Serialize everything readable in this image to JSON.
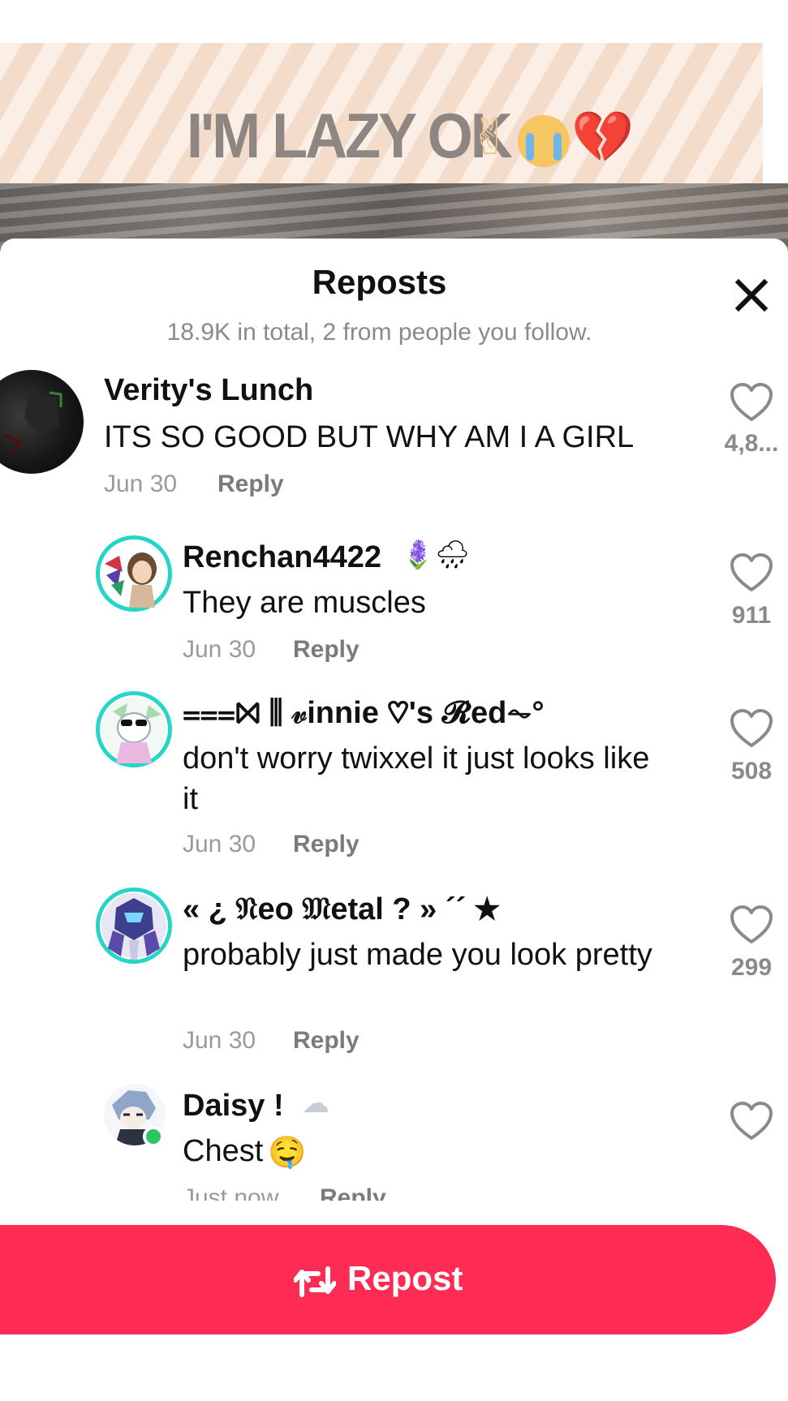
{
  "video": {
    "banner_text": "I'M LAZY OK",
    "banner_emojis": [
      "✌",
      "😭",
      "💔"
    ]
  },
  "sheet": {
    "title": "Reposts",
    "subtitle": "18.9K in total, 2 from people you follow."
  },
  "comments": [
    {
      "username": "Verity's Lunch",
      "text": "ITS SO GOOD BUT WHY AM I A GIRL",
      "date": "Jun 30",
      "reply_label": "Reply",
      "likes": "4,8..."
    },
    {
      "username": "Renchan4422",
      "name_emojis": [
        "🪻",
        "🌧"
      ],
      "text": "They are muscles",
      "date": "Jun 30",
      "reply_label": "Reply",
      "likes": "911"
    },
    {
      "username": "⩶⨝ ⫼ 𝓋innie ♡'s 𝓡ed⏦°",
      "text": "don't worry twixxel it just looks like it",
      "date": "Jun 30",
      "reply_label": "Reply",
      "likes": "508"
    },
    {
      "username": "« ¿ 𝔑eo 𝔐etal ? » ´´ ★",
      "text": "probably just made you look pretty",
      "date": "Jun 30",
      "reply_label": "Reply",
      "likes": "299"
    },
    {
      "username": "Daisy !",
      "name_emojis": [
        "☁"
      ],
      "text": "Chest",
      "text_emoji": "🤤",
      "date": "Just now",
      "reply_label": "Reply",
      "likes": ""
    }
  ],
  "repost_button": {
    "label": "Repost"
  },
  "colors": {
    "accent": "#fe2c55",
    "ring": "#25d6c8",
    "online": "#2bc466"
  },
  "icons": {
    "close": "close-icon",
    "like": "heart-icon",
    "repost": "repost-icon"
  }
}
